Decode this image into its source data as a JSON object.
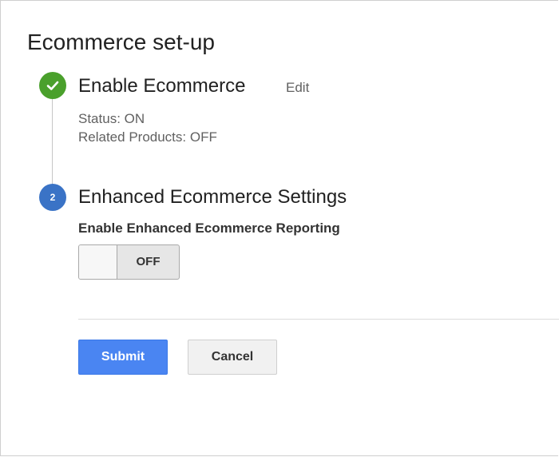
{
  "page": {
    "title": "Ecommerce set-up"
  },
  "steps": [
    {
      "icon": "checkmark-icon",
      "title": "Enable Ecommerce",
      "edit_label": "Edit",
      "status": "Status: ON",
      "related_products": "Related Products: OFF"
    },
    {
      "number": "2",
      "title": "Enhanced Ecommerce Settings",
      "setting_label": "Enable Enhanced Ecommerce Reporting",
      "toggle_state": "OFF"
    }
  ],
  "actions": {
    "submit_label": "Submit",
    "cancel_label": "Cancel"
  },
  "colors": {
    "step_complete": "#4aa02c",
    "step_current": "#3a73c6",
    "submit_button": "#4a85f2"
  }
}
